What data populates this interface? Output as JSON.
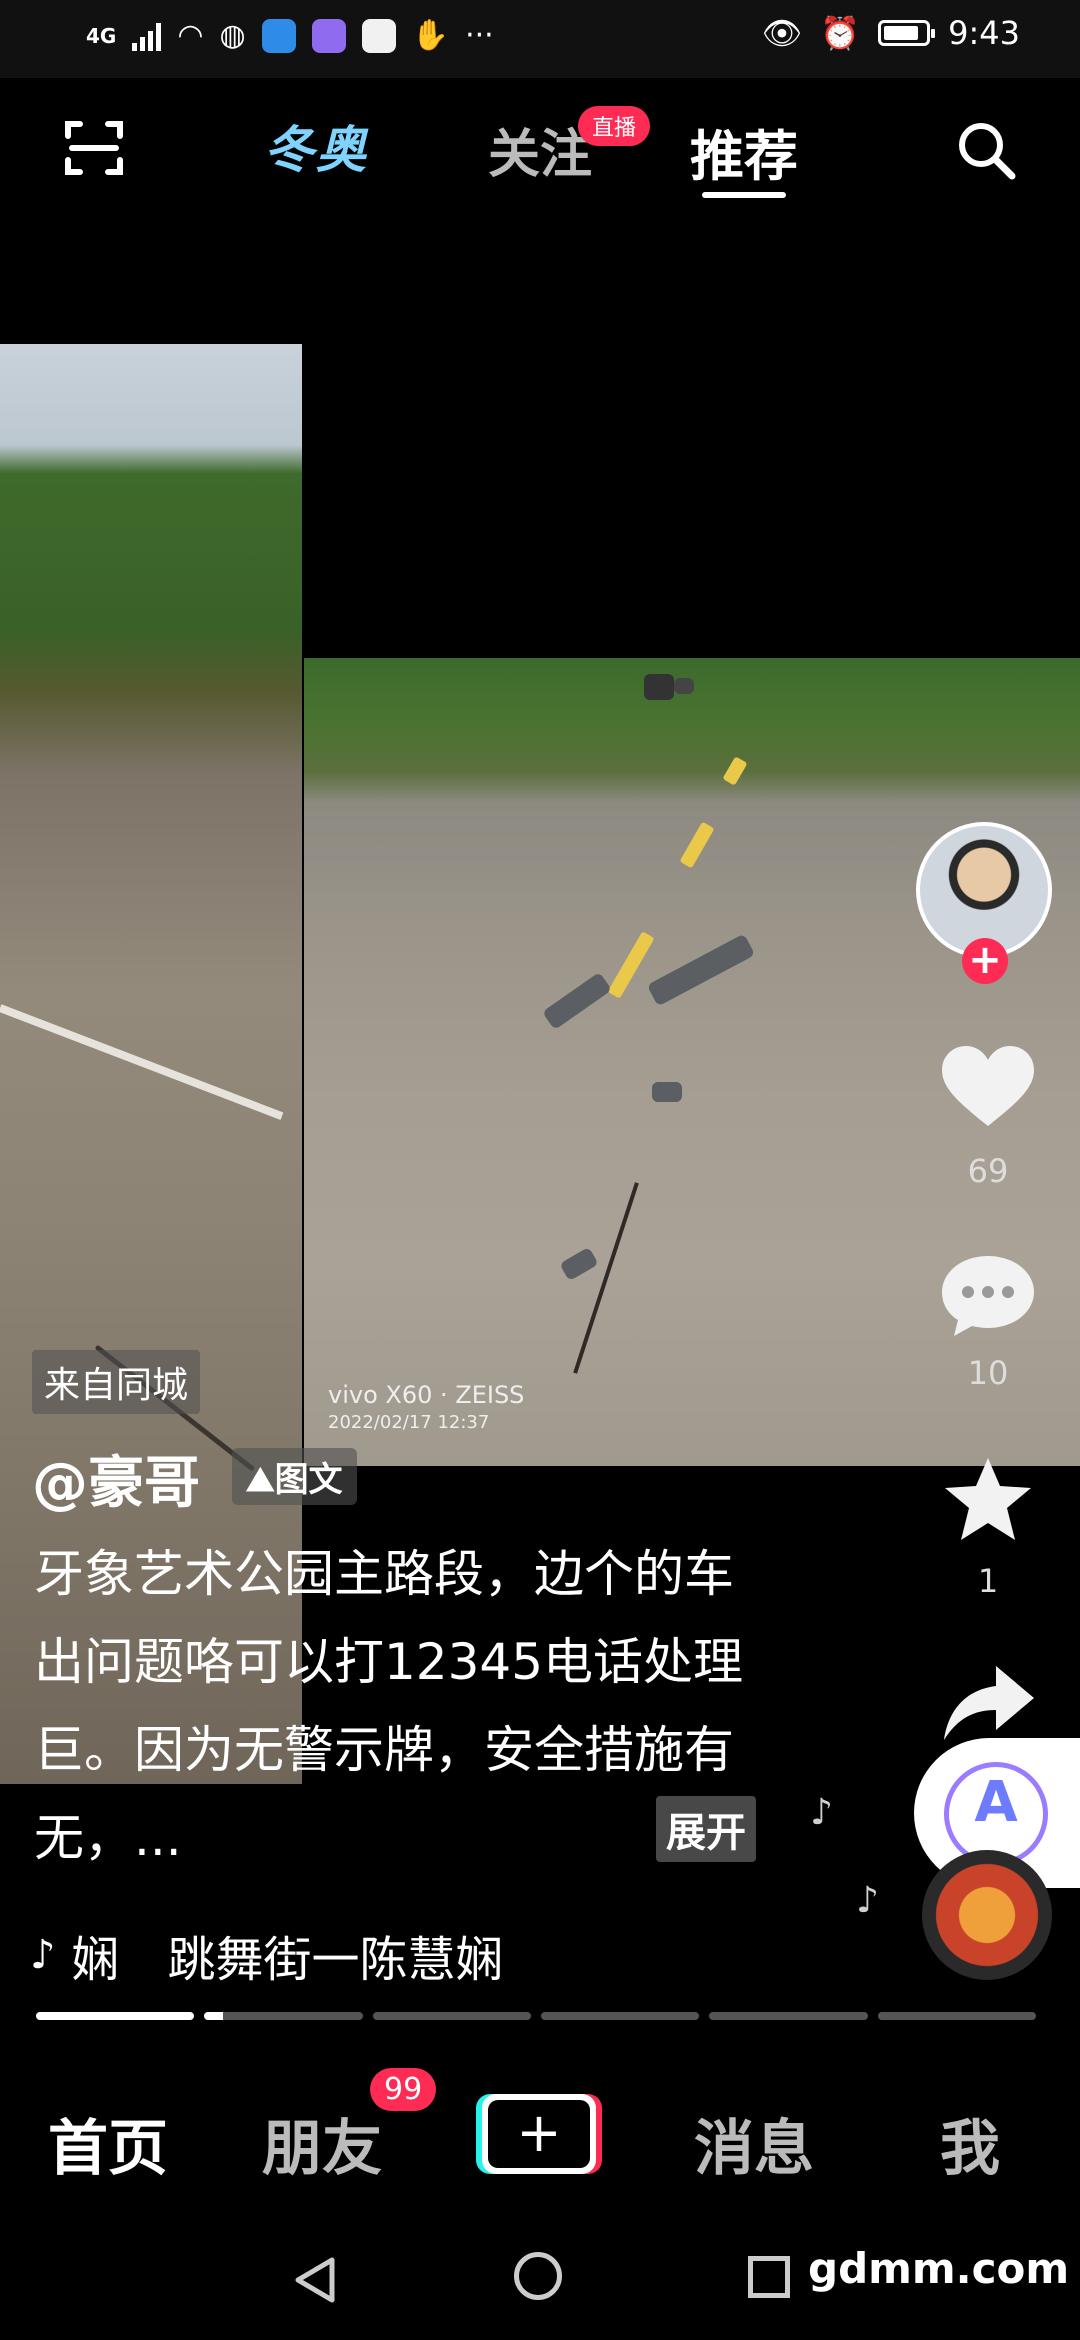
{
  "status_bar": {
    "network": "4G",
    "time": "9:43",
    "more_glyph": "···"
  },
  "top_nav": {
    "tabs": [
      {
        "label": "冬奥"
      },
      {
        "label": "关注",
        "badge": "直播"
      },
      {
        "label": "推荐",
        "active": true
      }
    ]
  },
  "post": {
    "location_tag": "来自同城",
    "author": "@豪哥",
    "type_tag": "图文",
    "caption": "牙象艺术公园主路段，边个的车出问题咯可以打12345电话处理巨。因为无警示牌，安全措施有无，...",
    "expand_label": "展开",
    "photo_watermark_line1": "vivo X60 · ZEISS",
    "photo_watermark_line2": "2022/02/17 12:37",
    "music": "娴　跳舞街一陈慧娴",
    "progress": {
      "segments": 6,
      "current": 2
    }
  },
  "actions": {
    "likes": "69",
    "comments": "10",
    "favorites": "1",
    "assist_label": "A"
  },
  "bottom_tabs": {
    "home": "首页",
    "friends": "朋友",
    "friends_badge": "99",
    "create": "+",
    "messages": "消息",
    "me": "我"
  },
  "site_mark": "gdmm.com",
  "colors": {
    "accent_red": "#fe2c55",
    "winter_blue": "#7fd4ff",
    "cyan": "#25f4ee"
  }
}
